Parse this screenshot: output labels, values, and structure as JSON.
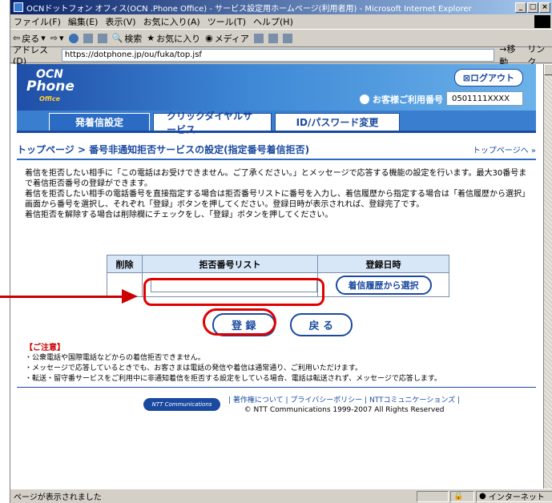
{
  "window": {
    "title": "OCNドットフォン オフィス(OCN .Phone Office) - サービス設定用ホームページ(利用者用) - Microsoft Internet Explorer"
  },
  "menu": [
    "ファイル(F)",
    "編集(E)",
    "表示(V)",
    "お気に入り(A)",
    "ツール(T)",
    "ヘルプ(H)"
  ],
  "toolbar": {
    "back": "戻る",
    "search": "検索",
    "favorites": "お気に入り",
    "media": "メディア"
  },
  "address": {
    "label": "アドレス(D)",
    "url": "https://dotphone.jp/ou/fuka/top.jsf",
    "go": "移動",
    "links": "リンク"
  },
  "header": {
    "brand_line1": "OCN",
    "brand_line2": "Phone",
    "brand_line3": "Office",
    "logout": "ログアウト",
    "customer_label": "お客様ご利用番号",
    "customer_number": "0501111XXXX"
  },
  "tabs": [
    "発着信設定",
    "クリックダイヤルサービス",
    "ID/パスワード変更"
  ],
  "breadcrumb": {
    "title": "トップページ > 番号非通知拒否サービスの設定(指定番号着信拒否)",
    "top_link": "トップページへ »"
  },
  "description": [
    "着信を拒否したい相手に「この電話はお受けできません。ご了承ください。」とメッセージで応答する機能の設定を行います。最大30番号まで着信拒否番号の登録ができます。",
    "着信を拒否したい相手の電話番号を直接指定する場合は拒否番号リストに番号を入力し、着信履歴から指定する場合は「着信履歴から選択」画面から番号を選択し、それぞれ「登録」ボタンを押してください。登録日時が表示されれば、登録完了です。",
    "着信拒否を解除する場合は削除欄にチェックをし、「登録」ボタンを押してください。"
  ],
  "table": {
    "headers": [
      "削除",
      "拒否番号リスト",
      "登録日時"
    ],
    "input_value": "",
    "history_button": "着信履歴から選択"
  },
  "buttons": {
    "register": "登 録",
    "back": "戻 る"
  },
  "notes": {
    "title": "【ご注意】",
    "items": [
      "・公衆電話や国際電話などからの着信拒否できません。",
      "・メッセージで応答しているときでも、お客さまは電話の発信や着信は通常通り、ご利用いただけます。",
      "・転送・留守番サービスをご利用中に非通知着信を拒否する設定をしている場合、電話は転送されず、メッセージで応答します。"
    ]
  },
  "footer": {
    "logo": "NTT Communications",
    "links": "| 著作権について | プライバシーポリシー | NTTコミュニケーションズ |",
    "copyright": "© NTT Communications 1999-2007 All Rights Reserved"
  },
  "status": {
    "text": "ページが表示されました",
    "zone": "インターネット"
  }
}
